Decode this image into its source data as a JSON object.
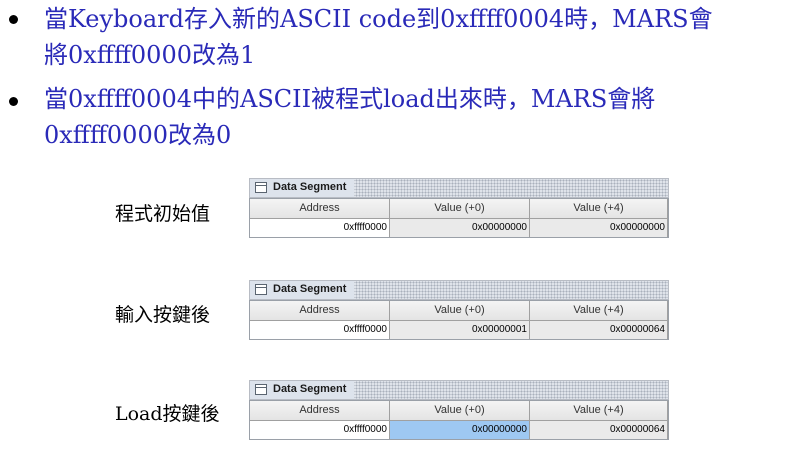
{
  "bullets": [
    {
      "line1": "當Keyboard存入新的ASCII code到0xffff0004時，MARS會",
      "line2": "將0xffff0000改為1"
    },
    {
      "line1": "當0xffff0004中的ASCII被程式load出來時，MARS會將",
      "line2": "0xffff0000改為0"
    }
  ],
  "panels": [
    {
      "label": "程式初始值",
      "title": "Data Segment",
      "columns": [
        "Address",
        "Value (+0)",
        "Value (+4)"
      ],
      "row": [
        "0xffff0000",
        "0x00000000",
        "0x00000000"
      ],
      "selected_cell": null
    },
    {
      "label": "輸入按鍵後",
      "title": "Data Segment",
      "columns": [
        "Address",
        "Value (+0)",
        "Value (+4)"
      ],
      "row": [
        "0xffff0000",
        "0x00000001",
        "0x00000064"
      ],
      "selected_cell": null
    },
    {
      "label": "Load按鍵後",
      "title": "Data Segment",
      "columns": [
        "Address",
        "Value (+0)",
        "Value (+4)"
      ],
      "row": [
        "0xffff0000",
        "0x00000000",
        "0x00000064"
      ],
      "selected_cell": "value_plus0"
    }
  ],
  "colors": {
    "bullet_text": "#2a2ab8",
    "selected_cell": "#9ec8f2"
  },
  "icons": [
    "bullet-dot",
    "panel-window-icon"
  ]
}
